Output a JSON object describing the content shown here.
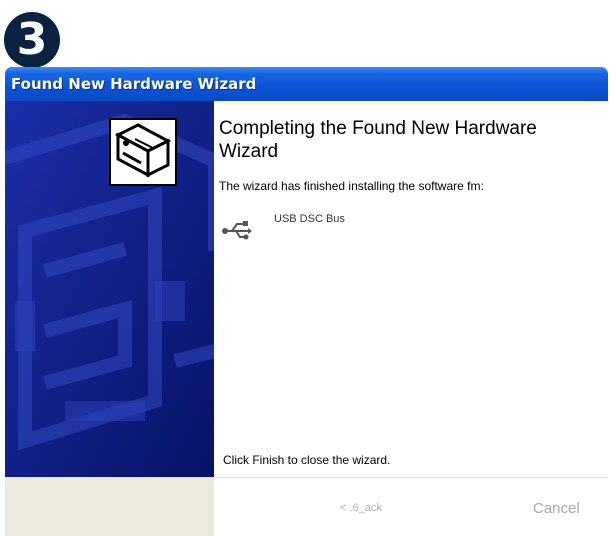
{
  "step_badge": "3",
  "window": {
    "title": "Found New Hardware Wizard"
  },
  "content": {
    "heading": "Completing the Found New Hardware Wizard",
    "description": "The wizard has finished installing the software fm:",
    "device_name": "USB DSC Bus",
    "close_hint": "Click Finish to close the wizard."
  },
  "buttons": {
    "back_label": "< .6_ack",
    "cancel_label": "Cancel"
  },
  "colors": {
    "titlebar": "#0b55d7",
    "banner": "#0d1b8a",
    "badge": "#0b2240"
  },
  "icons": {
    "banner": "hardware-drive-icon",
    "device": "usb-icon"
  }
}
